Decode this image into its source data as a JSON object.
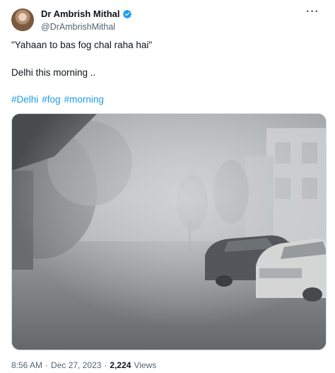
{
  "author": {
    "display_name": "Dr Ambrish Mithal",
    "handle": "@DrAmbrishMithal",
    "verified": true,
    "verified_color": "#1d9bf0"
  },
  "tweet": {
    "line1": "\"Yahaan to bas fog chal raha hai\"",
    "line2": "Delhi this morning ..",
    "hashtags": [
      "#Delhi",
      "#fog",
      "#morning"
    ],
    "hashtag_color": "#1d9bf0"
  },
  "media": {
    "alt": "Foggy morning street in Delhi with parked cars"
  },
  "meta": {
    "time": "8:56 AM",
    "separator1": "·",
    "date": "Dec 27, 2023",
    "separator2": "·",
    "views_count": "2,224",
    "views_label": "Views"
  },
  "icons": {
    "more": "more-options-icon",
    "verified": "verified-badge-icon"
  }
}
